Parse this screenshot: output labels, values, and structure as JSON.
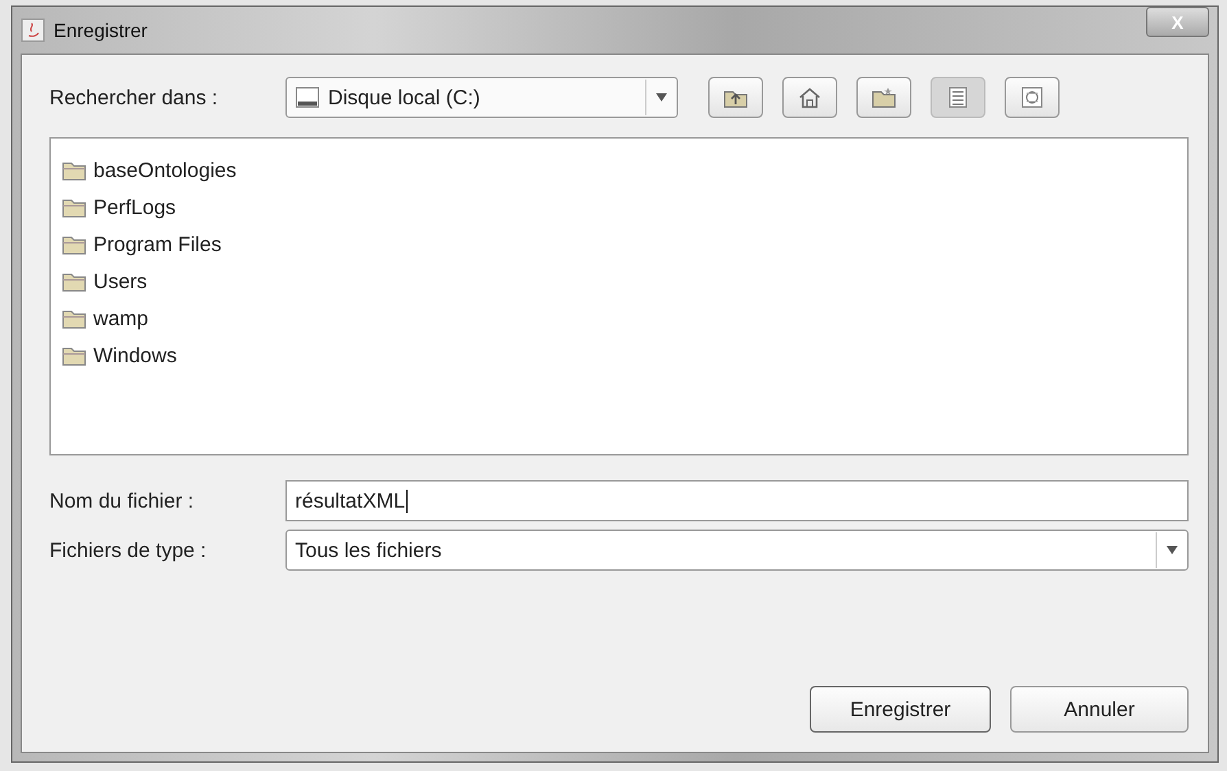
{
  "window": {
    "title": "Enregistrer",
    "close": "X"
  },
  "look_in": {
    "label": "Rechercher dans :",
    "value": "Disque local (C:)"
  },
  "toolbar": [
    {
      "kind": "up",
      "selected": false
    },
    {
      "kind": "home",
      "selected": false
    },
    {
      "kind": "new-folder",
      "selected": false
    },
    {
      "kind": "list",
      "selected": true
    },
    {
      "kind": "details",
      "selected": false
    }
  ],
  "files": [
    {
      "name": "baseOntologies"
    },
    {
      "name": "PerfLogs"
    },
    {
      "name": "Program Files"
    },
    {
      "name": "Users"
    },
    {
      "name": "wamp"
    },
    {
      "name": "Windows"
    }
  ],
  "file_name": {
    "label": "Nom du fichier :",
    "value": "résultatXML"
  },
  "file_type": {
    "label": "Fichiers de type :",
    "value": "Tous les fichiers"
  },
  "buttons": [
    {
      "label": "Enregistrer",
      "kind": "default"
    },
    {
      "label": "Annuler",
      "kind": "normal"
    }
  ]
}
